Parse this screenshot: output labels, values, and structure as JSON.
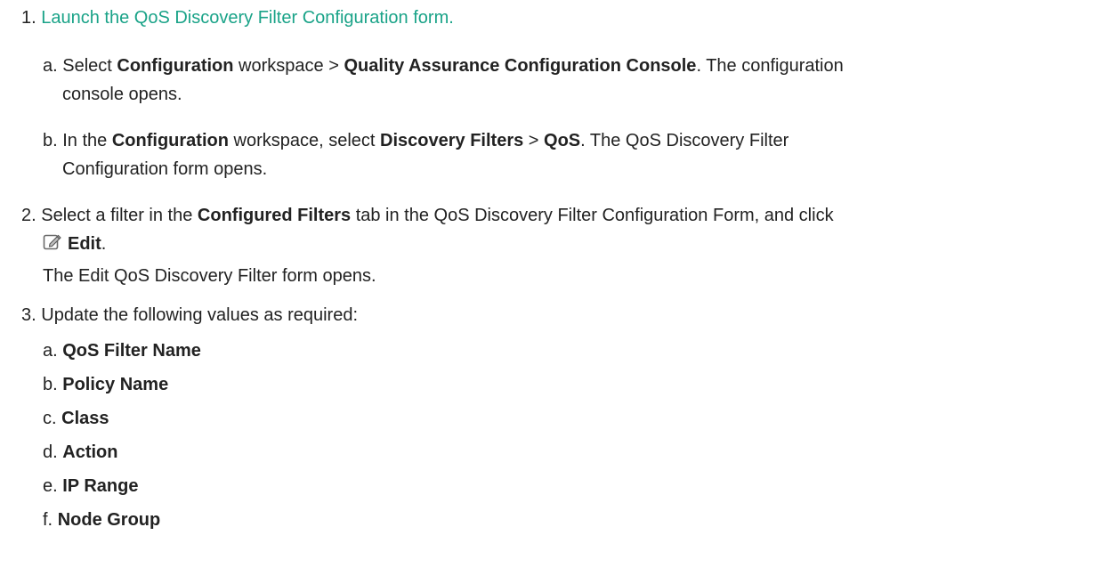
{
  "steps": {
    "s1": {
      "num": "1.",
      "link_text": "Launch the QoS Discovery Filter Configuration form.",
      "a": {
        "label": "a.",
        "t1": "Select ",
        "b1": "Configuration",
        "t2": " workspace > ",
        "b2": "Quality Assurance Configuration Console",
        "t3": ". The configuration",
        "t4": "console opens."
      },
      "b": {
        "label": "b.",
        "t1": "In the ",
        "b1": "Configuration",
        "t2": " workspace, select ",
        "b2": "Discovery Filters",
        "t3": " > ",
        "b3": "QoS",
        "t4": ". The QoS Discovery Filter",
        "t5": "Configuration form opens."
      }
    },
    "s2": {
      "num": "2.",
      "t1": "Select a filter in the ",
      "b1": "Configured Filters",
      "t2": " tab in the QoS Discovery Filter Configuration Form, and click",
      "edit_icon": "pencil-edit-icon",
      "edit_label": "Edit",
      "edit_period": ".",
      "note": "The Edit QoS Discovery Filter form opens."
    },
    "s3": {
      "num": "3.",
      "text": "Update the following values as required:",
      "items": [
        {
          "label": "a.",
          "value": "QoS Filter Name"
        },
        {
          "label": "b.",
          "value": "Policy Name"
        },
        {
          "label": "c.",
          "value": "Class"
        },
        {
          "label": "d.",
          "value": "Action"
        },
        {
          "label": "e.",
          "value": "IP Range"
        },
        {
          "label": "f.",
          "value": "Node Group"
        }
      ]
    }
  },
  "colors": {
    "link": "#1aa388",
    "text": "#222222"
  }
}
